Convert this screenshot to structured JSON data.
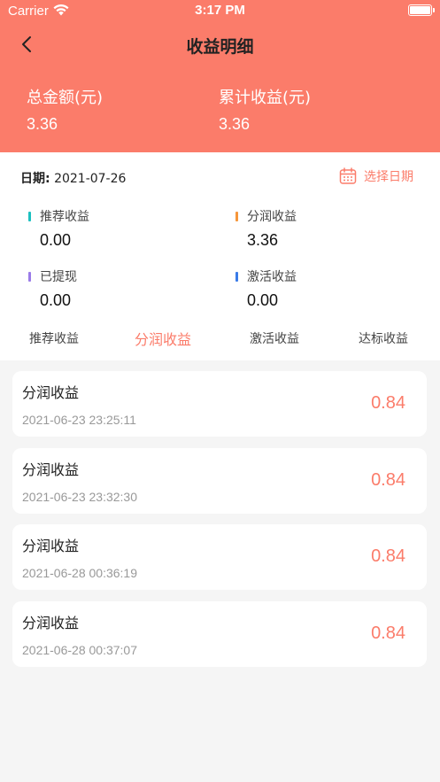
{
  "status": {
    "carrier": "Carrier",
    "time": "3:17 PM"
  },
  "nav": {
    "title": "收益明细",
    "back_icon": "chevron-left-icon"
  },
  "summary": {
    "total_label": "总金额(元)",
    "total_value": "3.36",
    "cumulative_label": "累计收益(元)",
    "cumulative_value": "3.36"
  },
  "filter": {
    "date_label": "日期:",
    "date_value": "2021-07-26",
    "picker_label": "选择日期",
    "picker_icon": "calendar-icon"
  },
  "stats": [
    {
      "label": "推荐收益",
      "value": "0.00",
      "color": "#1cc0c0"
    },
    {
      "label": "分润收益",
      "value": "3.36",
      "color": "#f6963a"
    },
    {
      "label": "已提现",
      "value": "0.00",
      "color": "#9a7be8"
    },
    {
      "label": "激活收益",
      "value": "0.00",
      "color": "#3a7be8"
    }
  ],
  "tabs": [
    {
      "label": "推荐收益",
      "active": false
    },
    {
      "label": "分润收益",
      "active": true
    },
    {
      "label": "激活收益",
      "active": false
    },
    {
      "label": "达标收益",
      "active": false
    }
  ],
  "records": [
    {
      "title": "分润收益",
      "time": "2021-06-23 23:25:11",
      "amount": "0.84"
    },
    {
      "title": "分润收益",
      "time": "2021-06-23 23:32:30",
      "amount": "0.84"
    },
    {
      "title": "分润收益",
      "time": "2021-06-28 00:36:19",
      "amount": "0.84"
    },
    {
      "title": "分润收益",
      "time": "2021-06-28 00:37:07",
      "amount": "0.84"
    }
  ],
  "colors": {
    "accent": "#fb7c6a"
  }
}
